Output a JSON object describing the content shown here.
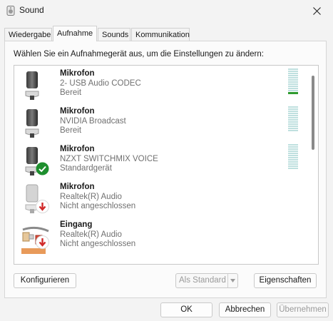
{
  "window": {
    "title": "Sound",
    "close_icon": "close-icon"
  },
  "tabs": [
    {
      "label": "Wiedergabe",
      "active": false
    },
    {
      "label": "Aufnahme",
      "active": true
    },
    {
      "label": "Sounds",
      "active": false
    },
    {
      "label": "Kommunikation",
      "active": false
    }
  ],
  "panel": {
    "instruction": "Wählen Sie ein Aufnahmegerät aus, um die Einstellungen zu ändern:"
  },
  "devices": [
    {
      "name": "Mikrofon",
      "line1": "2- USB Audio CODEC",
      "line2": "Bereit",
      "icon": "microphone-icon",
      "badge": null,
      "level_active": true
    },
    {
      "name": "Mikrofon",
      "line1": "NVIDIA Broadcast",
      "line2": "Bereit",
      "icon": "microphone-icon",
      "badge": null,
      "level_active": false
    },
    {
      "name": "Mikrofon",
      "line1": "NZXT SWITCHMIX VOICE",
      "line2": "Standardgerät",
      "icon": "microphone-icon",
      "badge": "default-check-icon",
      "level_active": false
    },
    {
      "name": "Mikrofon",
      "line1": "Realtek(R) Audio",
      "line2": "Nicht angeschlossen",
      "icon": "microphone-icon",
      "badge": "disconnected-arrow-icon",
      "level_active": false
    },
    {
      "name": "Eingang",
      "line1": "Realtek(R) Audio",
      "line2": "Nicht angeschlossen",
      "icon": "line-in-cable-icon",
      "badge": "disconnected-arrow-icon",
      "level_active": false
    }
  ],
  "buttons": {
    "configure": "Konfigurieren",
    "set_default": "Als Standard",
    "properties": "Eigenschaften",
    "ok": "OK",
    "cancel": "Abbrechen",
    "apply": "Übernehmen"
  },
  "colors": {
    "accent_green": "#2f9b2f",
    "disconnected_red": "#d02a2a",
    "meter_idle": "#bfe0df"
  }
}
